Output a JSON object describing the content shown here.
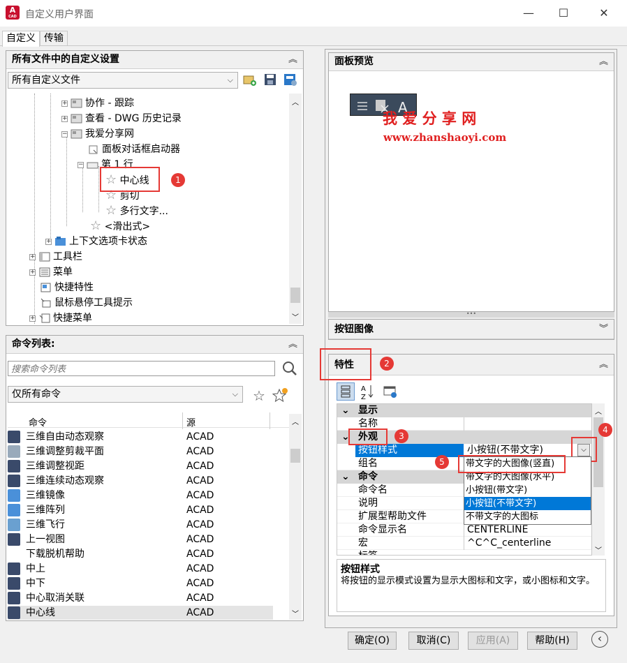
{
  "window": {
    "title": "自定义用户界面",
    "minimize": "—",
    "maximize": "☐",
    "close": "✕"
  },
  "app_icon": {
    "letter": "A",
    "sub": "CAD"
  },
  "tabs": [
    "自定义",
    "传输"
  ],
  "customizations": {
    "header": "所有文件中的自定义设置",
    "combo_value": "所有自定义文件",
    "tree": [
      {
        "label": "协作 - 跟踪"
      },
      {
        "label": "查看 - DWG 历史记录"
      },
      {
        "label": "我爱分享网"
      },
      {
        "label": "面板对话框启动器"
      },
      {
        "label": "第 1 行"
      },
      {
        "label": "中心线"
      },
      {
        "label": "剪切"
      },
      {
        "label": "多行文字..."
      },
      {
        "label": "<滑出式>"
      },
      {
        "label": "上下文选项卡状态"
      },
      {
        "label": "工具栏"
      },
      {
        "label": "菜单"
      },
      {
        "label": "快捷特性"
      },
      {
        "label": "鼠标悬停工具提示"
      },
      {
        "label": "快捷菜单"
      }
    ]
  },
  "command_list": {
    "header": "命令列表:",
    "search_placeholder": "搜索命令列表",
    "filter_value": "仅所有命令",
    "columns": [
      "命令",
      "源"
    ],
    "rows": [
      {
        "name": "三维自由动态观察",
        "source": "ACAD"
      },
      {
        "name": "三维调整剪裁平面",
        "source": "ACAD"
      },
      {
        "name": "三维调整视距",
        "source": "ACAD"
      },
      {
        "name": "三维连续动态观察",
        "source": "ACAD"
      },
      {
        "name": "三维镜像",
        "source": "ACAD"
      },
      {
        "name": "三维阵列",
        "source": "ACAD"
      },
      {
        "name": "三维飞行",
        "source": "ACAD"
      },
      {
        "name": "上一视图",
        "source": "ACAD"
      },
      {
        "name": "下载脱机帮助",
        "source": "ACAD"
      },
      {
        "name": "中上",
        "source": "ACAD"
      },
      {
        "name": "中下",
        "source": "ACAD"
      },
      {
        "name": "中心取消关联",
        "source": "ACAD"
      },
      {
        "name": "中心线",
        "source": "ACAD"
      }
    ]
  },
  "panel_preview": {
    "header": "面板预览",
    "watermark_cn": "我 爱 分 享 网",
    "watermark_url": "www.zhanshaoyi.com"
  },
  "button_image": {
    "header": "按钮图像"
  },
  "properties": {
    "header": "特性",
    "categories": {
      "display": "显示",
      "appearance": "外观",
      "command": "命令"
    },
    "rows": {
      "name": {
        "label": "名称",
        "value": ""
      },
      "button_style": {
        "label": "按钮样式",
        "value": "小按钮(不带文字)"
      },
      "group_name": {
        "label": "组名",
        "value": ""
      },
      "command_name": {
        "label": "命令名",
        "value": ""
      },
      "description": {
        "label": "说明",
        "value": ""
      },
      "ext_help": {
        "label": "扩展型帮助文件",
        "value": ""
      },
      "command_display": {
        "label": "命令显示名",
        "value": "CENTERLINE"
      },
      "macro": {
        "label": "宏",
        "value": "^C^C_centerline"
      },
      "tags": {
        "label": "标签",
        "value": ""
      }
    },
    "dropdown_options": [
      "带文字的大图像(竖直)",
      "带文字的大图像(水平)",
      "小按钮(带文字)",
      "小按钮(不带文字)",
      "不带文字的大图标"
    ],
    "dropdown_selected": "小按钮(不带文字)",
    "desc_title": "按钮样式",
    "desc_text": "将按钮的显示模式设置为显示大图标和文字，或小图标和文字。"
  },
  "annotations": [
    "1",
    "2",
    "3",
    "4",
    "5"
  ],
  "footer": {
    "ok": "确定(O)",
    "cancel": "取消(C)",
    "apply": "应用(A)",
    "help": "帮助(H)"
  },
  "colors": {
    "accent_red": "#e53935",
    "selection_blue": "#0078d7",
    "watermark_red": "#e02020"
  }
}
